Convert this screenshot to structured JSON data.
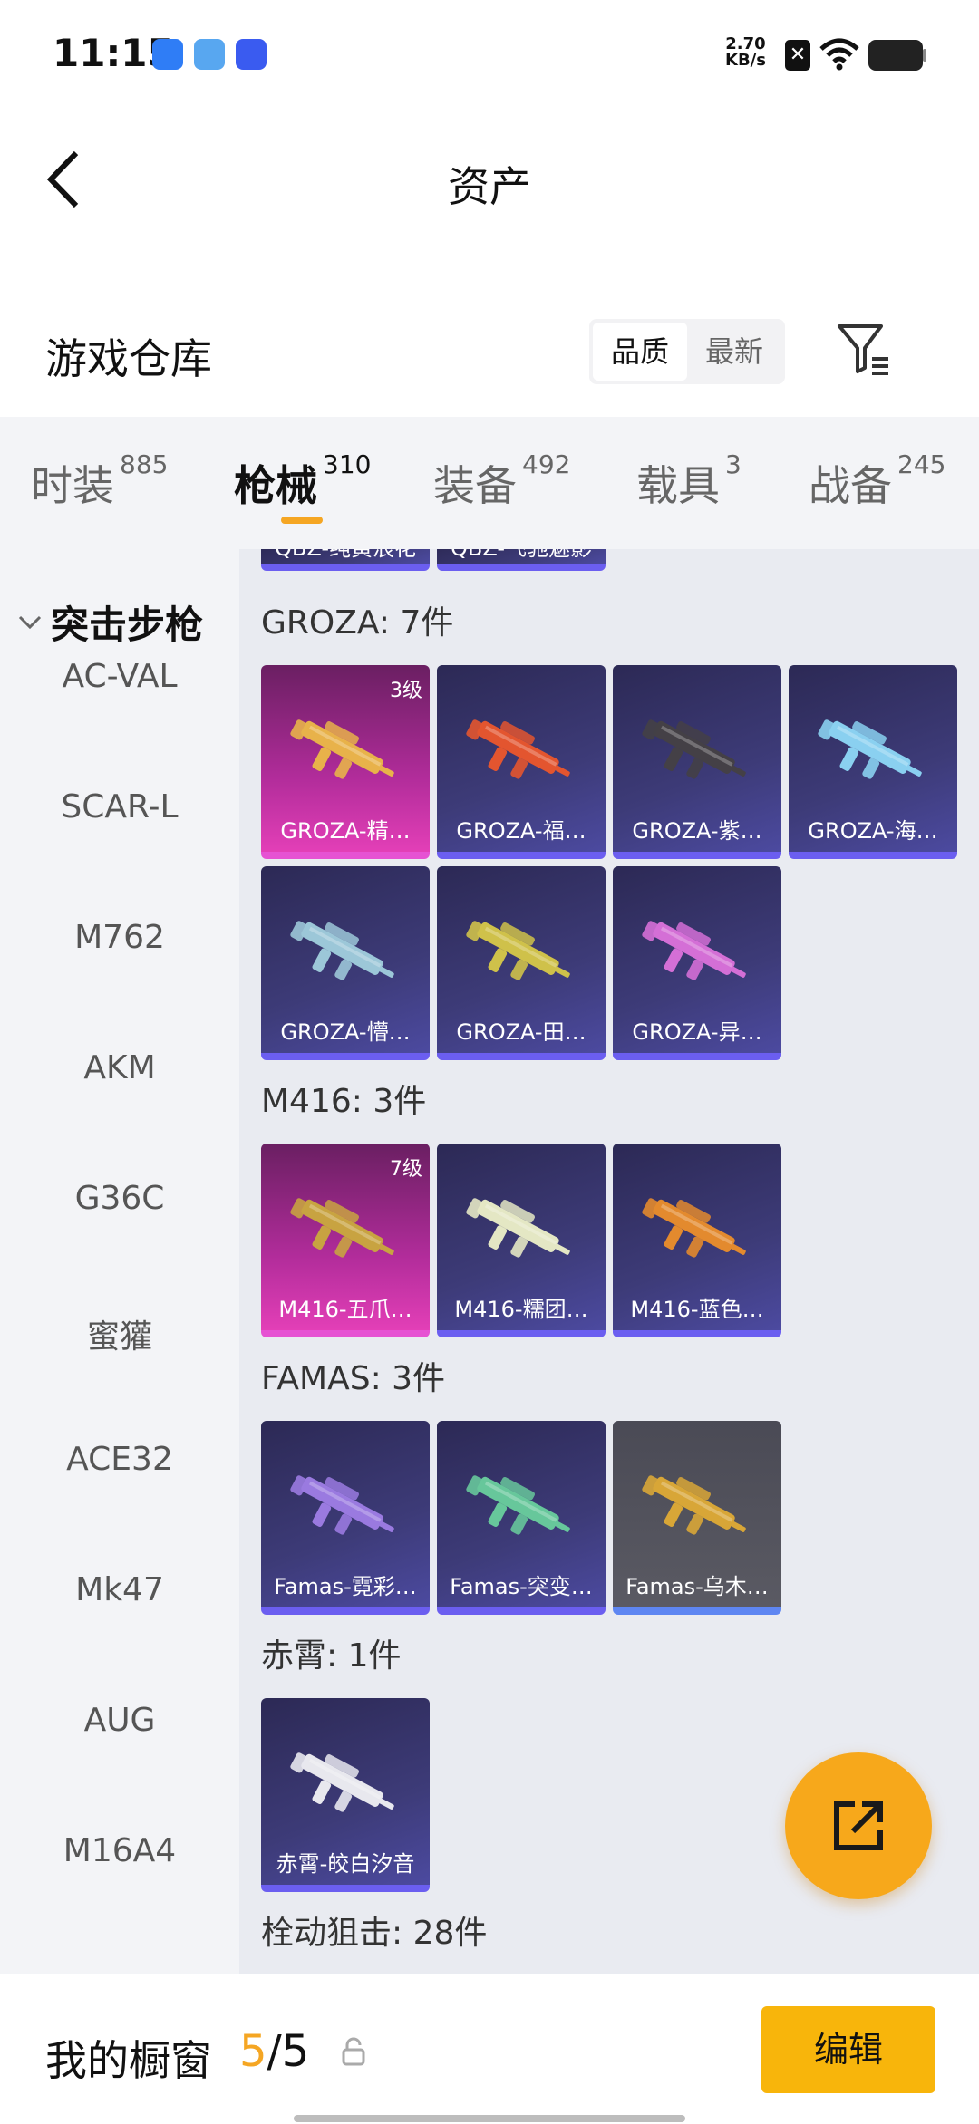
{
  "status": {
    "time": "11:15",
    "speed_value": "2.70",
    "speed_unit": "KB/s",
    "app_icons": [
      "#2f7df6",
      "#58a7f0",
      "#3a5bf0"
    ]
  },
  "header": {
    "title": "资产"
  },
  "section": {
    "title": "游戏仓库",
    "sort": [
      "品质",
      "最新"
    ],
    "sort_active": 0
  },
  "tabs": [
    {
      "label": "时装",
      "count": "885"
    },
    {
      "label": "枪械",
      "count": "310"
    },
    {
      "label": "装备",
      "count": "492"
    },
    {
      "label": "载具",
      "count": "3"
    },
    {
      "label": "战备",
      "count": "245"
    }
  ],
  "active_tab": 1,
  "sidebar": {
    "header": "突击步枪",
    "items": [
      "AC-VAL",
      "SCAR-L",
      "M762",
      "AKM",
      "G36C",
      "蜜獾",
      "ACE32",
      "Mk47",
      "AUG",
      "M16A4"
    ]
  },
  "content": {
    "top_partial": [
      "QBZ-纯黄浪花",
      "QBZ-飞驰魅影"
    ],
    "groups": [
      {
        "title": "GROZA: 7件",
        "cards": [
          {
            "name": "GROZA-精…",
            "level": "3级",
            "rarity": "legend",
            "gun_color": "#e8b24a"
          },
          {
            "name": "GROZA-福…",
            "level": "",
            "rarity": "epic",
            "gun_color": "#e3552f"
          },
          {
            "name": "GROZA-紫…",
            "level": "",
            "rarity": "epic",
            "gun_color": "#444046"
          },
          {
            "name": "GROZA-海…",
            "level": "",
            "rarity": "epic",
            "gun_color": "#8ad0f0"
          },
          {
            "name": "GROZA-懵…",
            "level": "",
            "rarity": "epic",
            "gun_color": "#9cc7d8"
          },
          {
            "name": "GROZA-田…",
            "level": "",
            "rarity": "epic",
            "gun_color": "#cfc14a"
          },
          {
            "name": "GROZA-异…",
            "level": "",
            "rarity": "epic",
            "gun_color": "#d46fd6"
          }
        ]
      },
      {
        "title": "M416: 3件",
        "cards": [
          {
            "name": "M416-五爪…",
            "level": "7级",
            "rarity": "legend",
            "gun_color": "#c8a341"
          },
          {
            "name": "M416-糯团…",
            "level": "",
            "rarity": "epic",
            "gun_color": "#e4e7c4"
          },
          {
            "name": "M416-蓝色…",
            "level": "",
            "rarity": "epic",
            "gun_color": "#e38a2e"
          }
        ]
      },
      {
        "title": "FAMAS: 3件",
        "cards": [
          {
            "name": "Famas-霓彩…",
            "level": "",
            "rarity": "epic",
            "gun_color": "#9a7ae0"
          },
          {
            "name": "Famas-突变…",
            "level": "",
            "rarity": "epic",
            "gun_color": "#67c79b"
          },
          {
            "name": "Famas-乌木…",
            "level": "",
            "rarity": "grey",
            "gun_color": "#d8a637"
          }
        ]
      },
      {
        "title": "赤霄: 1件",
        "cards": [
          {
            "name": "赤霄-皎白汐音",
            "level": "",
            "rarity": "epic",
            "gun_color": "#e8e8ee"
          }
        ]
      }
    ],
    "next_group_title": "栓动狙击: 28件"
  },
  "bottom": {
    "label": "我的橱窗",
    "current": "5",
    "total": "/5",
    "edit": "编辑"
  }
}
